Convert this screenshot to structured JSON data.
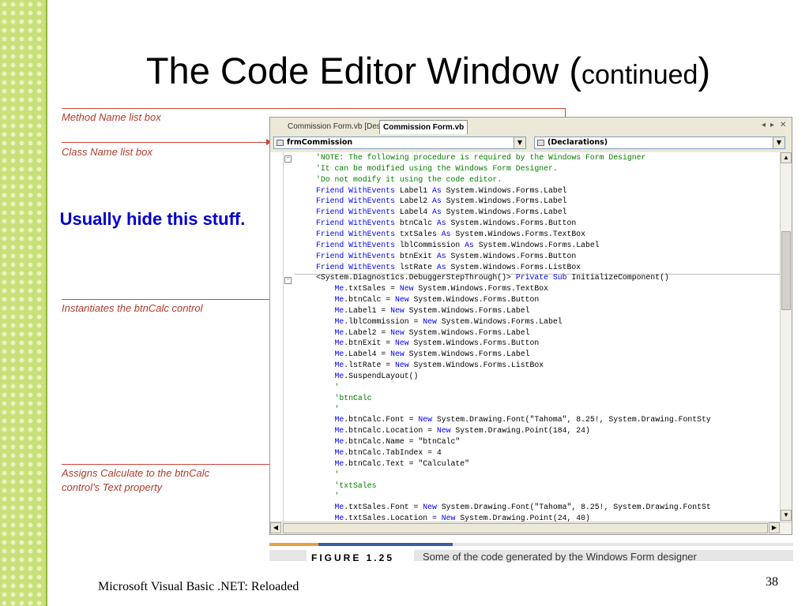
{
  "slide": {
    "title_main": "The Code Editor Window (",
    "title_small": "continued",
    "title_close": ")",
    "note": "Usually hide this stuff.",
    "footer": "Microsoft Visual Basic .NET: Reloaded",
    "page_number": "38",
    "accent_color": "#c9e07a"
  },
  "callouts": {
    "method_name": "Method Name list box",
    "class_name": "Class Name list box",
    "instantiates": "Instantiates the btnCalc control",
    "assigns_line1": "Assigns Calculate to the btnCalc",
    "assigns_line2": "control’s Text property"
  },
  "editor": {
    "tabs": [
      "Commission Form.vb [Design]",
      "Commission Form.vb"
    ],
    "active_tab": 1,
    "tab_controls": {
      "left": "◂",
      "right": "▸",
      "close": "✕"
    },
    "class_combo": "frmCommission",
    "method_combo": "(Declarations)",
    "code_lines": [
      {
        "indent": "",
        "parts": [
          {
            "t": "'NOTE: The following procedure is required by the Windows Form Designer",
            "c": "cm"
          }
        ]
      },
      {
        "indent": "",
        "parts": [
          {
            "t": "'It can be modified using the Windows Form Designer.",
            "c": "cm"
          }
        ]
      },
      {
        "indent": "",
        "parts": [
          {
            "t": "'Do not modify it using the code editor.",
            "c": "cm"
          }
        ]
      },
      {
        "indent": "",
        "parts": [
          {
            "t": "Friend WithEvents",
            "c": "kw"
          },
          {
            "t": " Label1 "
          },
          {
            "t": "As",
            "c": "kw"
          },
          {
            "t": " System.Windows.Forms.Label"
          }
        ]
      },
      {
        "indent": "",
        "parts": [
          {
            "t": "Friend WithEvents",
            "c": "kw"
          },
          {
            "t": " Label2 "
          },
          {
            "t": "As",
            "c": "kw"
          },
          {
            "t": " System.Windows.Forms.Label"
          }
        ]
      },
      {
        "indent": "",
        "parts": [
          {
            "t": "Friend WithEvents",
            "c": "kw"
          },
          {
            "t": " Label4 "
          },
          {
            "t": "As",
            "c": "kw"
          },
          {
            "t": " System.Windows.Forms.Label"
          }
        ]
      },
      {
        "indent": "",
        "parts": [
          {
            "t": "Friend WithEvents",
            "c": "kw"
          },
          {
            "t": " btnCalc "
          },
          {
            "t": "As",
            "c": "kw"
          },
          {
            "t": " System.Windows.Forms.Button"
          }
        ]
      },
      {
        "indent": "",
        "parts": [
          {
            "t": "Friend WithEvents",
            "c": "kw"
          },
          {
            "t": " txtSales "
          },
          {
            "t": "As",
            "c": "kw"
          },
          {
            "t": " System.Windows.Forms.TextBox"
          }
        ]
      },
      {
        "indent": "",
        "parts": [
          {
            "t": "Friend WithEvents",
            "c": "kw"
          },
          {
            "t": " lblCommission "
          },
          {
            "t": "As",
            "c": "kw"
          },
          {
            "t": " System.Windows.Forms.Label"
          }
        ]
      },
      {
        "indent": "",
        "parts": [
          {
            "t": "Friend WithEvents",
            "c": "kw"
          },
          {
            "t": " btnExit "
          },
          {
            "t": "As",
            "c": "kw"
          },
          {
            "t": " System.Windows.Forms.Button"
          }
        ]
      },
      {
        "indent": "",
        "parts": [
          {
            "t": "Friend WithEvents",
            "c": "kw"
          },
          {
            "t": " lstRate "
          },
          {
            "t": "As",
            "c": "kw"
          },
          {
            "t": " System.Windows.Forms.ListBox"
          }
        ]
      },
      {
        "indent": "",
        "parts": [
          {
            "t": "<System.Diagnostics.DebuggerStepThrough()> "
          },
          {
            "t": "Private Sub",
            "c": "kw"
          },
          {
            "t": " InitializeComponent()"
          }
        ]
      },
      {
        "indent": "    ",
        "parts": [
          {
            "t": "Me",
            "c": "kw"
          },
          {
            "t": ".txtSales = "
          },
          {
            "t": "New",
            "c": "kw"
          },
          {
            "t": " System.Windows.Forms.TextBox"
          }
        ]
      },
      {
        "indent": "    ",
        "parts": [
          {
            "t": "Me",
            "c": "kw"
          },
          {
            "t": ".btnCalc = "
          },
          {
            "t": "New",
            "c": "kw"
          },
          {
            "t": " System.Windows.Forms.Button"
          }
        ]
      },
      {
        "indent": "    ",
        "parts": [
          {
            "t": "Me",
            "c": "kw"
          },
          {
            "t": ".Label1 = "
          },
          {
            "t": "New",
            "c": "kw"
          },
          {
            "t": " System.Windows.Forms.Label"
          }
        ]
      },
      {
        "indent": "    ",
        "parts": [
          {
            "t": "Me",
            "c": "kw"
          },
          {
            "t": ".lblCommission = "
          },
          {
            "t": "New",
            "c": "kw"
          },
          {
            "t": " System.Windows.Forms.Label"
          }
        ]
      },
      {
        "indent": "    ",
        "parts": [
          {
            "t": "Me",
            "c": "kw"
          },
          {
            "t": ".Label2 = "
          },
          {
            "t": "New",
            "c": "kw"
          },
          {
            "t": " System.Windows.Forms.Label"
          }
        ]
      },
      {
        "indent": "    ",
        "parts": [
          {
            "t": "Me",
            "c": "kw"
          },
          {
            "t": ".btnExit = "
          },
          {
            "t": "New",
            "c": "kw"
          },
          {
            "t": " System.Windows.Forms.Button"
          }
        ]
      },
      {
        "indent": "    ",
        "parts": [
          {
            "t": "Me",
            "c": "kw"
          },
          {
            "t": ".Label4 = "
          },
          {
            "t": "New",
            "c": "kw"
          },
          {
            "t": " System.Windows.Forms.Label"
          }
        ]
      },
      {
        "indent": "    ",
        "parts": [
          {
            "t": "Me",
            "c": "kw"
          },
          {
            "t": ".lstRate = "
          },
          {
            "t": "New",
            "c": "kw"
          },
          {
            "t": " System.Windows.Forms.ListBox"
          }
        ]
      },
      {
        "indent": "    ",
        "parts": [
          {
            "t": "Me",
            "c": "kw"
          },
          {
            "t": ".SuspendLayout()"
          }
        ]
      },
      {
        "indent": "    ",
        "parts": [
          {
            "t": "'",
            "c": "cm"
          }
        ]
      },
      {
        "indent": "    ",
        "parts": [
          {
            "t": "'btnCalc",
            "c": "cm"
          }
        ]
      },
      {
        "indent": "    ",
        "parts": [
          {
            "t": "'",
            "c": "cm"
          }
        ]
      },
      {
        "indent": "    ",
        "parts": [
          {
            "t": "Me",
            "c": "kw"
          },
          {
            "t": ".btnCalc.Font = "
          },
          {
            "t": "New",
            "c": "kw"
          },
          {
            "t": " System.Drawing.Font(\"Tahoma\", 8.25!, System.Drawing.FontSty"
          }
        ]
      },
      {
        "indent": "    ",
        "parts": [
          {
            "t": "Me",
            "c": "kw"
          },
          {
            "t": ".btnCalc.Location = "
          },
          {
            "t": "New",
            "c": "kw"
          },
          {
            "t": " System.Drawing.Point(184, 24)"
          }
        ]
      },
      {
        "indent": "    ",
        "parts": [
          {
            "t": "Me",
            "c": "kw"
          },
          {
            "t": ".btnCalc.Name = \"btnCalc\""
          }
        ]
      },
      {
        "indent": "    ",
        "parts": [
          {
            "t": "Me",
            "c": "kw"
          },
          {
            "t": ".btnCalc.TabIndex = 4"
          }
        ]
      },
      {
        "indent": "    ",
        "parts": [
          {
            "t": "Me",
            "c": "kw"
          },
          {
            "t": ".btnCalc.Text = \"Calculate\""
          }
        ]
      },
      {
        "indent": "    ",
        "parts": [
          {
            "t": "'",
            "c": "cm"
          }
        ]
      },
      {
        "indent": "    ",
        "parts": [
          {
            "t": "'txtSales",
            "c": "cm"
          }
        ]
      },
      {
        "indent": "    ",
        "parts": [
          {
            "t": "'",
            "c": "cm"
          }
        ]
      },
      {
        "indent": "    ",
        "parts": [
          {
            "t": "Me",
            "c": "kw"
          },
          {
            "t": ".txtSales.Font = "
          },
          {
            "t": "New",
            "c": "kw"
          },
          {
            "t": " System.Drawing.Font(\"Tahoma\", 8.25!, System.Drawing.FontSt"
          }
        ]
      },
      {
        "indent": "    ",
        "parts": [
          {
            "t": "Me",
            "c": "kw"
          },
          {
            "t": ".txtSales.Location = "
          },
          {
            "t": "New",
            "c": "kw"
          },
          {
            "t": " System.Drawing.Point(24, 40)"
          }
        ]
      }
    ],
    "colors": {
      "keyword": "#0000ff",
      "comment": "#008000",
      "text": "#000000"
    }
  },
  "figure": {
    "label": "FIGURE 1.25",
    "caption": "Some of the code generated by the Windows Form designer"
  }
}
